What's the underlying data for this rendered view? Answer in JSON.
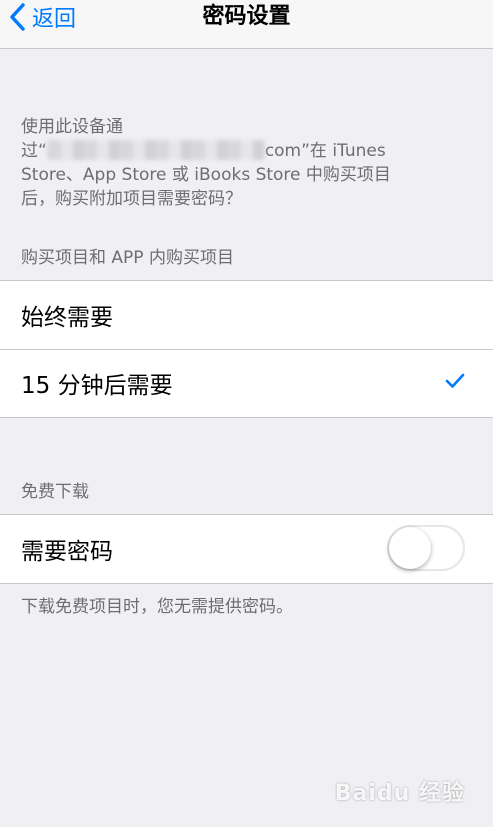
{
  "nav": {
    "back_label": "返回",
    "title": "密码设置"
  },
  "description": {
    "line1": "使用此设备通",
    "line2_prefix": "过“",
    "line2_suffix": "com”在 iTunes",
    "line3": "Store、App Store 或 iBooks Store 中购买项目",
    "line4": "后，购买附加项目需要密码？"
  },
  "purchase_section": {
    "header": "购买项目和 APP 内购买项目",
    "options": [
      {
        "label": "始终需要",
        "selected": false
      },
      {
        "label": "15 分钟后需要",
        "selected": true
      }
    ]
  },
  "free_section": {
    "header": "免费下载",
    "toggle_label": "需要密码",
    "toggle_on": false,
    "footer": "下载免费项目时，您无需提供密码。"
  },
  "watermark": "Baidu 经验",
  "colors": {
    "accent": "#007aff",
    "background": "#efeff4",
    "separator": "#c8c7cc",
    "secondary_text": "#6d6d72"
  },
  "icons": {
    "back": "chevron-left-icon",
    "selected": "checkmark-icon"
  }
}
